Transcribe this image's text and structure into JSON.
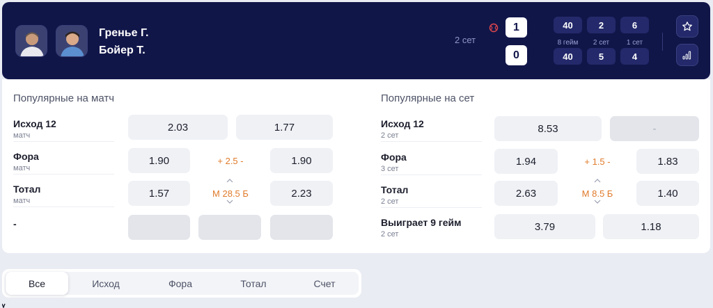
{
  "match": {
    "player1": "Гренье Г.",
    "player2": "Бойер Т.",
    "current_set_label": "2 сет",
    "sets": [
      "1",
      "0"
    ],
    "columns": [
      {
        "top": "40",
        "bottom": "40",
        "label": "8 гейм"
      },
      {
        "top": "2",
        "bottom": "5",
        "label": "2 сет"
      },
      {
        "top": "6",
        "bottom": "4",
        "label": "1 сет"
      }
    ]
  },
  "popular_match": {
    "title": "Популярные на матч",
    "rows": [
      {
        "label": "Исход 12",
        "sub": "матч",
        "odd1": "2.03",
        "param": "",
        "odd2": "1.77"
      },
      {
        "label": "Фора",
        "sub": "матч",
        "odd1": "1.90",
        "param": "+ 2.5 -",
        "odd2": "1.90"
      },
      {
        "label": "Тотал",
        "sub": "матч",
        "odd1": "1.57",
        "param": "М 28.5 Б",
        "odd2": "2.23"
      },
      {
        "label": "-",
        "sub": "",
        "odd1": "",
        "param": "",
        "odd2": ""
      }
    ]
  },
  "popular_set": {
    "title": "Популярные на сет",
    "rows": [
      {
        "label": "Исход 12",
        "sub": "2 сет",
        "odd1": "8.53",
        "param": "",
        "odd2": "-"
      },
      {
        "label": "Фора",
        "sub": "3 сет",
        "odd1": "1.94",
        "param": "+ 1.5 -",
        "odd2": "1.83"
      },
      {
        "label": "Тотал",
        "sub": "2 сет",
        "odd1": "2.63",
        "param": "М 8.5 Б",
        "odd2": "1.40"
      },
      {
        "label": "Выиграет 9 гейм",
        "sub": "2 сет",
        "odd1": "3.79",
        "param": "",
        "odd2": "1.18"
      }
    ]
  },
  "tabs": [
    "Все",
    "Исход",
    "Фора",
    "Тотал",
    "Счет"
  ],
  "colors": {
    "header_bg": "#111649",
    "accent_orange": "#e07b2a"
  }
}
